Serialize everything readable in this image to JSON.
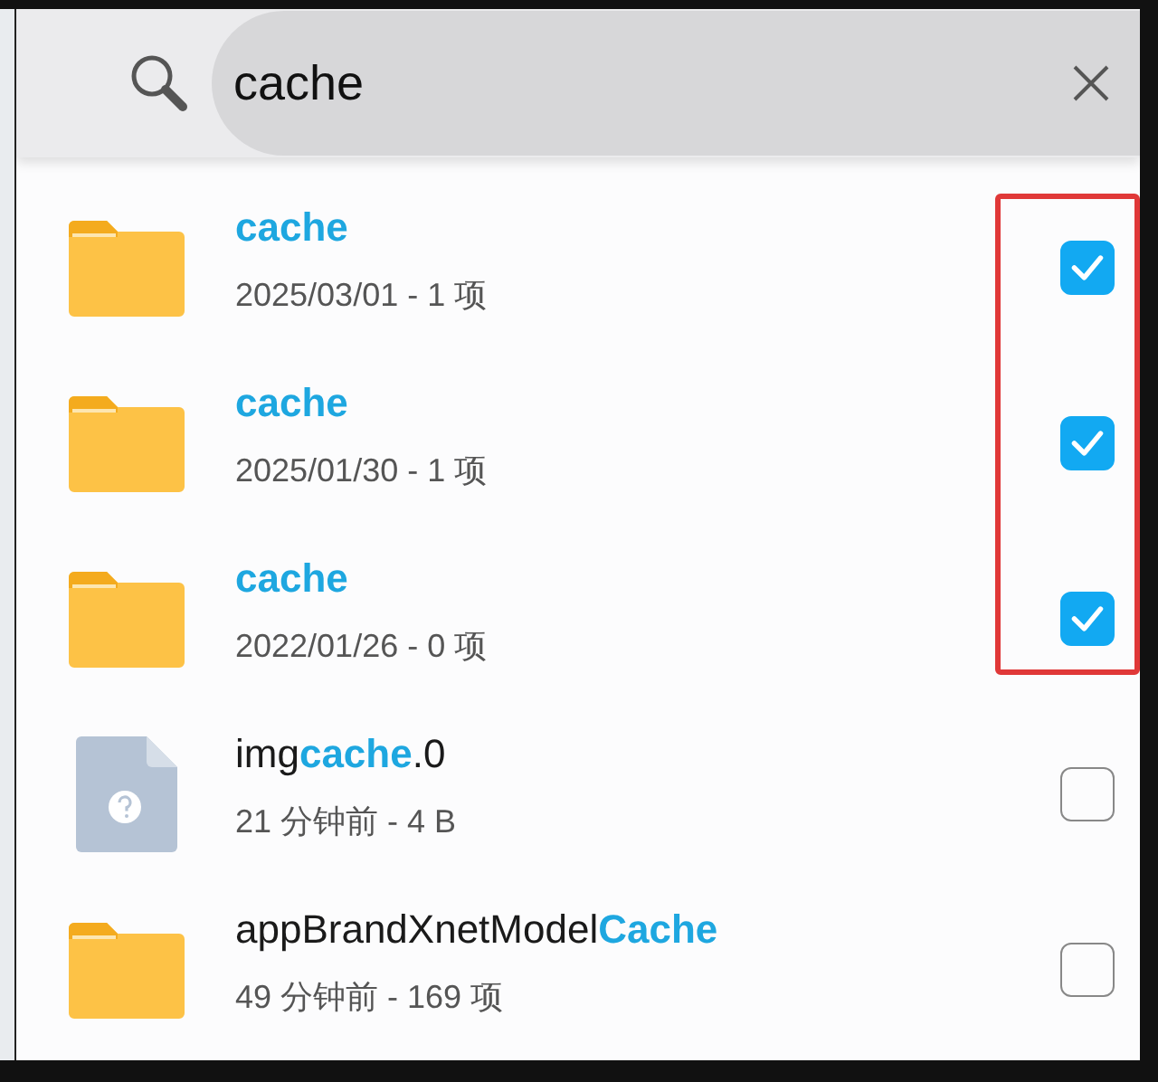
{
  "search": {
    "value": "cache"
  },
  "results": [
    {
      "kind": "folder",
      "name": [
        {
          "text": "cache",
          "match": true
        }
      ],
      "details": "2025/03/01 - 1 项",
      "checked": true
    },
    {
      "kind": "folder",
      "name": [
        {
          "text": "cache",
          "match": true
        }
      ],
      "details": "2025/01/30 - 1 项",
      "checked": true
    },
    {
      "kind": "folder",
      "name": [
        {
          "text": "cache",
          "match": true
        }
      ],
      "details": "2022/01/26 - 0 项",
      "checked": true
    },
    {
      "kind": "file",
      "name": [
        {
          "text": "img",
          "match": false
        },
        {
          "text": "cache",
          "match": true
        },
        {
          "text": ".0",
          "match": false
        }
      ],
      "details": "21 分钟前 - 4 B",
      "checked": false
    },
    {
      "kind": "folder",
      "name": [
        {
          "text": "appBrandXnetModel",
          "match": false
        },
        {
          "text": "Cache",
          "match": true
        }
      ],
      "details": "49 分钟前 - 169 项",
      "checked": false
    }
  ]
}
